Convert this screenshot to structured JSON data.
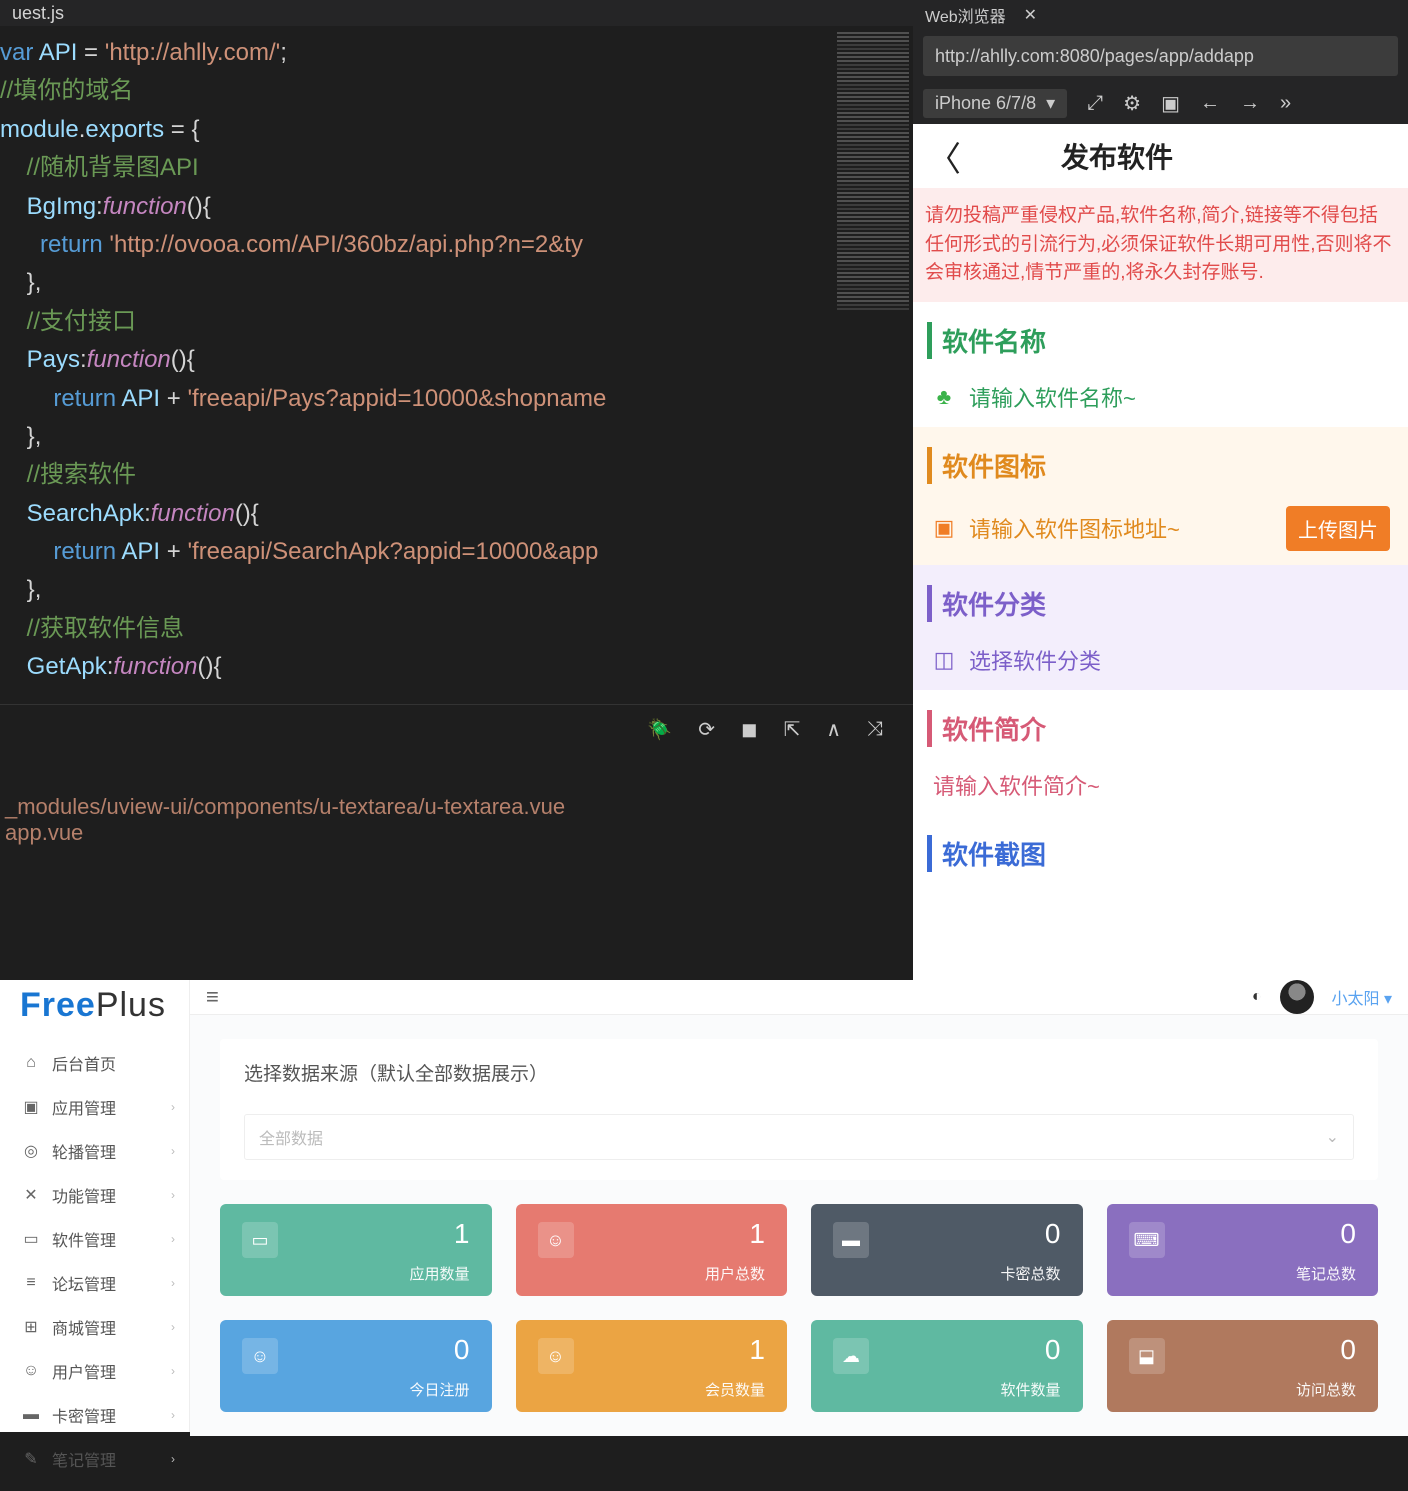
{
  "ide": {
    "file_tab": "uest.js",
    "code_html": "<span class='k-var'>var</span> <span class='k-id'>API</span> = <span class='k-str'>'http://ahlly.com/'</span>;\n<span class='k-cmt'>//填你的域名</span>\n<span class='k-id'>module</span>.<span class='k-id'>exports</span> = {\n    <span class='k-cmt'>//随机背景图API</span>\n    <span class='k-id'>BgImg</span>:<span class='k-kw'>function</span>(){\n      <span class='k-var'>return</span> <span class='k-str'>'http://ovooa.com/API/360bz/api.php?n=2&amp;ty</span>\n    },\n    <span class='k-cmt'>//支付接口</span>\n    <span class='k-id'>Pays</span>:<span class='k-kw'>function</span>(){\n        <span class='k-var'>return</span> <span class='k-id'>API</span> + <span class='k-str'>'freeapi/Pays?appid=10000&amp;shopname</span>\n    },\n    <span class='k-cmt'>//搜索软件</span>\n    <span class='k-id'>SearchApk</span>:<span class='k-kw'>function</span>(){\n        <span class='k-var'>return</span> <span class='k-id'>API</span> + <span class='k-str'>'freeapi/SearchApk?appid=10000&amp;app</span>\n    },\n    <span class='k-cmt'>//获取软件信息</span>\n    <span class='k-id'>GetApk</span>:<span class='k-kw'>function</span>(){",
    "terminal": {
      "line1": "_modules/uview-ui/components/u-textarea/u-textarea.vue",
      "line2": "app.vue"
    }
  },
  "preview": {
    "tab": "Web浏览器",
    "url": "http://ahlly.com:8080/pages/app/addapp",
    "device": "iPhone 6/7/8",
    "page_title": "发布软件",
    "warning": "请勿投稿严重侵权产品,软件名称,简介,链接等不得包括任何形式的引流行为,必须保证软件长期可用性,否则将不会审核通过,情节严重的,将永久封存账号.",
    "sections": {
      "name": {
        "title": "软件名称",
        "placeholder": "请输入软件名称~"
      },
      "icon": {
        "title": "软件图标",
        "placeholder": "请输入软件图标地址~",
        "upload": "上传图片"
      },
      "cate": {
        "title": "软件分类",
        "placeholder": "选择软件分类"
      },
      "intro": {
        "title": "软件简介",
        "placeholder": "请输入软件简介~"
      },
      "shot": {
        "title": "软件截图"
      }
    }
  },
  "dashboard": {
    "brand1": "Free",
    "brand2": "Plus",
    "user": "小太阳",
    "panel_title": "选择数据来源（默认全部数据展示）",
    "select_placeholder": "全部数据",
    "menu": [
      {
        "icon": "⌂",
        "label": "后台首页"
      },
      {
        "icon": "▣",
        "label": "应用管理",
        "arrow": true
      },
      {
        "icon": "◎",
        "label": "轮播管理",
        "arrow": true
      },
      {
        "icon": "✕",
        "label": "功能管理",
        "arrow": true
      },
      {
        "icon": "▭",
        "label": "软件管理",
        "arrow": true
      },
      {
        "icon": "≡",
        "label": "论坛管理",
        "arrow": true
      },
      {
        "icon": "⊞",
        "label": "商城管理",
        "arrow": true
      },
      {
        "icon": "☺",
        "label": "用户管理",
        "arrow": true
      },
      {
        "icon": "▬",
        "label": "卡密管理",
        "arrow": true
      },
      {
        "icon": "✎",
        "label": "笔记管理",
        "arrow": true
      }
    ],
    "cards": [
      {
        "color": "#5fb9a1",
        "icon": "▭",
        "value": "1",
        "label": "应用数量"
      },
      {
        "color": "#e67a70",
        "icon": "☺",
        "value": "1",
        "label": "用户总数"
      },
      {
        "color": "#4f5a66",
        "icon": "▬",
        "value": "0",
        "label": "卡密总数"
      },
      {
        "color": "#8a6fbf",
        "icon": "⌨",
        "value": "0",
        "label": "笔记总数"
      },
      {
        "color": "#58a5e0",
        "icon": "☺",
        "value": "0",
        "label": "今日注册"
      },
      {
        "color": "#eba443",
        "icon": "☺",
        "value": "1",
        "label": "会员数量"
      },
      {
        "color": "#5fb9a1",
        "icon": "☁",
        "value": "0",
        "label": "软件数量"
      },
      {
        "color": "#b0795e",
        "icon": "⬓",
        "value": "0",
        "label": "访问总数"
      }
    ]
  }
}
